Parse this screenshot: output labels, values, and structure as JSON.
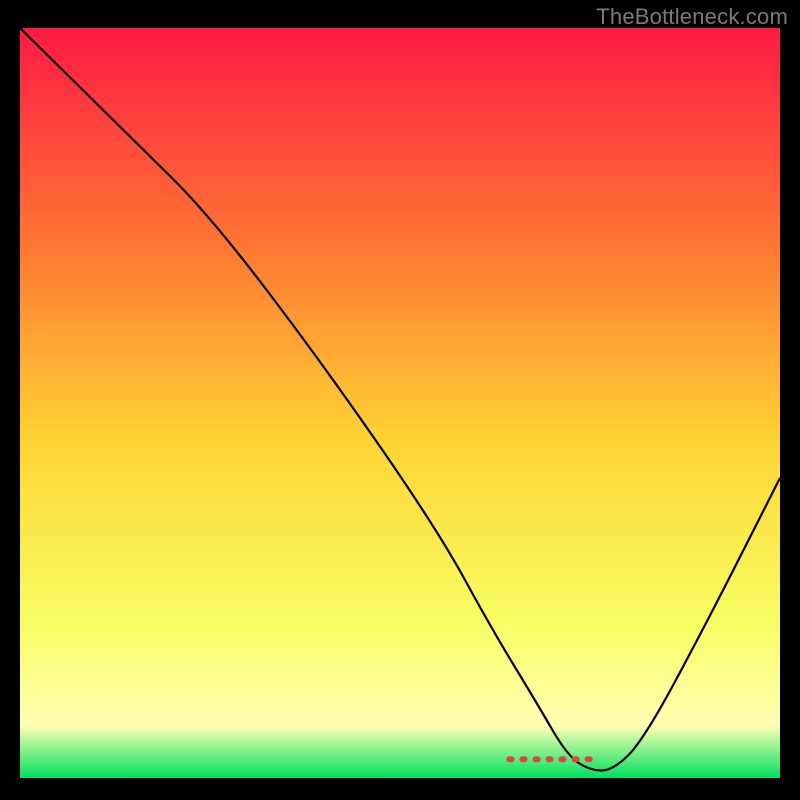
{
  "watermark": "TheBottleneck.com",
  "chart_data": {
    "type": "line",
    "title": "",
    "xlabel": "",
    "ylabel": "",
    "xlim": [
      0,
      100
    ],
    "ylim": [
      0,
      100
    ],
    "gradient_colors": {
      "top": "#ff1a44",
      "upper_mid": "#ff7a33",
      "mid": "#ffd433",
      "lower_mid": "#f7ff66",
      "near_bottom": "#ffffb3",
      "bottom": "#00e060"
    },
    "series": [
      {
        "name": "bottleneck-curve",
        "color": "#000000",
        "x": [
          0,
          15,
          25,
          40,
          55,
          62,
          68,
          72,
          75,
          78,
          82,
          90,
          100
        ],
        "y": [
          100,
          85,
          75,
          55,
          33,
          20,
          10,
          3,
          1,
          1,
          5,
          20,
          40
        ]
      }
    ],
    "marker": {
      "name": "optimal-range",
      "color": "#d94a3a",
      "x_start": 64,
      "x_end": 76,
      "y": 2.5
    }
  }
}
